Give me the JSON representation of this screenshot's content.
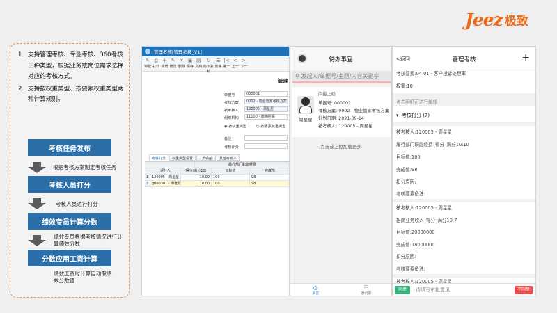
{
  "brand": {
    "logo_en": "Jeez",
    "logo_cn": "极致",
    "color": "#ea6a17"
  },
  "left": {
    "points": [
      {
        "num": "1.",
        "text": "支持管理考核、专业考核、360考核三种类型，根据业务或岗位需求选择对应的考核方式。"
      },
      {
        "num": "2.",
        "text": "支持按权重类型、按要素权重类型两种计算规则。"
      }
    ],
    "steps": [
      "考核任务发布",
      "考核人员打分",
      "绩效专员计算分数",
      "分数应用工资计算"
    ],
    "step_descs": [
      "根据考核方案制定考核任务",
      "考核人员进行打分",
      "绩效专员根据考核情况进行计算绩效分数",
      "绩效工资时计算自动取绩效分数值"
    ]
  },
  "desktop": {
    "title": "管理考核[管理考核_V1]",
    "toolbar": [
      {
        "icon": "✎",
        "label": "审批"
      },
      {
        "icon": "⎙",
        "label": "打印"
      },
      {
        "icon": "＋",
        "label": "新增"
      },
      {
        "icon": "✎",
        "label": "修改"
      },
      {
        "icon": "✕",
        "label": "删除"
      },
      {
        "icon": "▣",
        "label": "保存"
      },
      {
        "icon": "▤",
        "label": "文档"
      },
      {
        "icon": "↻",
        "label": "向下复制"
      },
      {
        "icon": "☰",
        "label": "表格"
      },
      {
        "icon": "|<",
        "label": "第一"
      },
      {
        "icon": "<",
        "label": "上一"
      },
      {
        "icon": ">",
        "label": "下一"
      }
    ],
    "heading": "管理",
    "form": [
      {
        "label": "单据号",
        "value": "000001"
      },
      {
        "label": "考核方案",
        "value": "0002 - 物业管家考核方案"
      },
      {
        "label": "被考核人",
        "value": "120005 - 周星星"
      },
      {
        "label": "组织机构",
        "value": "11100 - 南海控股"
      }
    ],
    "radio_a": "按权重类型",
    "radio_b": "按要素权重类型",
    "form_extra": [
      {
        "label": "备注"
      },
      {
        "label": "考核评分"
      }
    ],
    "tabs": [
      "考核打分",
      "权重类型设置",
      "工作内容",
      "其他考核人"
    ],
    "grid_group": "履行部门职能经费",
    "grid_headers": [
      "评分人",
      "得分(满分10)",
      "目标值",
      "完成值"
    ],
    "grid_rows": [
      {
        "no": "1",
        "rater": "120005 - 周星星",
        "score": "10.00",
        "target": "100",
        "done": "98"
      },
      {
        "no": "2",
        "rater": "g000301 - 谭老师",
        "score": "10.00",
        "target": "100",
        "done": "98"
      }
    ]
  },
  "mobile_todo": {
    "title": "待办事宜",
    "search_placeholder": "发起人/单据号/主题/内容关键字",
    "card": {
      "level": "间接上级",
      "name": "周星星",
      "lines": [
        "单据号: 000001",
        "考核方案: 0002 - 物业管家考核方案",
        "计划日期: 2021-09-14",
        "被考核人: 120005 - 周星星"
      ]
    },
    "load_more": "点击或上拉加载更多",
    "nav": [
      {
        "icon": "◎",
        "label": "消息"
      },
      {
        "icon": "☷",
        "label": "通讯录"
      }
    ]
  },
  "mobile_detail": {
    "back": "返回",
    "title": "管理考核",
    "plus": "+",
    "factor": "考核要素:04.01 - 客户投诉处理率",
    "weight": "权重:10",
    "hint": "点击明细可进行编辑",
    "section": "考核打分 (7)",
    "group1": [
      "被考核人:120005 - 周星星",
      "履行部门职能经费_得分_满分10:10",
      "目标值:100",
      "完成值:98",
      "扣分原因:",
      "考核要素备注:"
    ],
    "group2": [
      "被考核人:120005 - 周星星",
      "招商业务收入_得分_满分10:7",
      "目标值:20000000",
      "完成值:18000000",
      "扣分原因:",
      "考核要素备注:"
    ],
    "group3": [
      "被考核人:120005 - 周星星"
    ],
    "agree": "同意",
    "opinion_placeholder": "请填写审批意见",
    "disagree": "不同意"
  }
}
